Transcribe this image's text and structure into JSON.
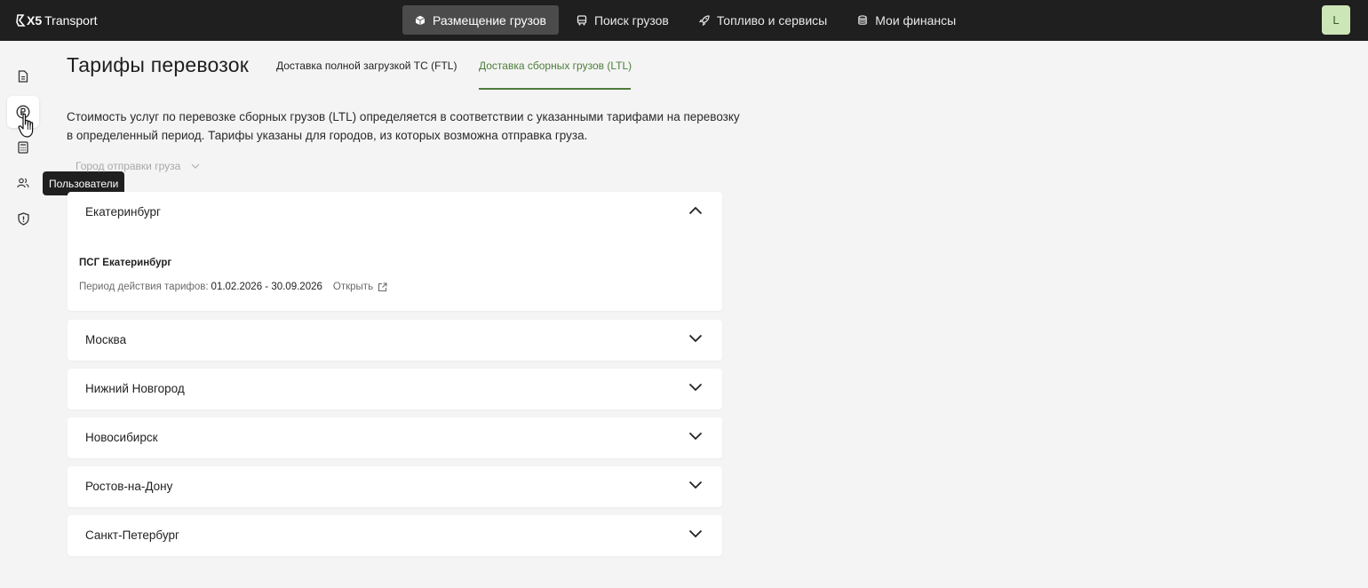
{
  "header": {
    "logo_brand": "X5",
    "logo_text": "Transport",
    "nav": [
      {
        "label": "Размещение грузов",
        "icon": "box-icon",
        "active": true
      },
      {
        "label": "Поиск грузов",
        "icon": "truck-icon",
        "active": false
      },
      {
        "label": "Топливо и сервисы",
        "icon": "rocket-icon",
        "active": false
      },
      {
        "label": "Мои финансы",
        "icon": "database-icon",
        "active": false
      }
    ],
    "avatar_letter": "L"
  },
  "sidebar": {
    "items": [
      {
        "icon": "document-icon"
      },
      {
        "icon": "ruble-coin-icon",
        "hovered": true
      },
      {
        "icon": "calculator-icon"
      },
      {
        "icon": "users-icon"
      },
      {
        "icon": "shield-icon"
      }
    ],
    "tooltip": "Пользователи"
  },
  "page": {
    "title": "Тарифы перевозок",
    "tabs": [
      {
        "label": "Доставка полной загрузкой ТС (FTL)",
        "active": false
      },
      {
        "label": "Доставка сборных грузов (LTL)",
        "active": true
      }
    ],
    "description": "Стоимость услуг по перевозке сборных грузов (LTL) определяется в соответствии с указанными тарифами на перевозку в определенный период. Тарифы указаны для городов, из которых возможна отправка груза.",
    "city_select_placeholder": "Город отправки груза"
  },
  "cities": [
    {
      "name": "Екатеринбург",
      "expanded": true,
      "depot": "ПСГ Екатеринбург",
      "period_label": "Период действия тарифов:",
      "period_dates": "01.02.2026 - 30.09.2026",
      "open_label": "Открыть"
    },
    {
      "name": "Москва",
      "expanded": false
    },
    {
      "name": "Нижний Новгород",
      "expanded": false
    },
    {
      "name": "Новосибирск",
      "expanded": false
    },
    {
      "name": "Ростов-на-Дону",
      "expanded": false
    },
    {
      "name": "Санкт-Петербург",
      "expanded": false
    }
  ],
  "colors": {
    "topbar": "#1f1f1f",
    "accent_green": "#4e7d3a",
    "avatar_bg": "#cde6b8",
    "page_bg": "#f4f4f4"
  }
}
